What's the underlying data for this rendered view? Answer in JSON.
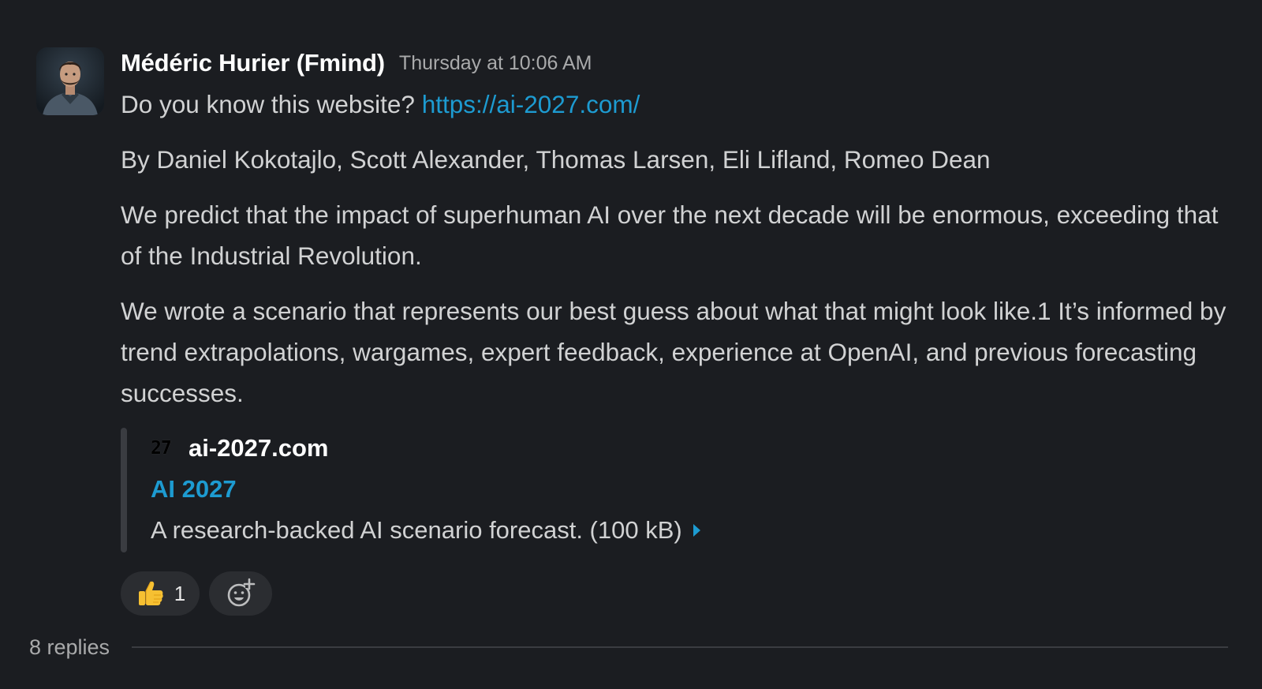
{
  "message": {
    "sender": "Médéric Hurier (Fmind)",
    "timestamp": "Thursday at 10:06 AM",
    "intro_text": "Do you know this website? ",
    "intro_link": "https://ai-2027.com/",
    "authors": "By Daniel Kokotajlo, Scott Alexander, Thomas Larsen, Eli Lifland, Romeo Dean",
    "paragraph_1": "We predict that the impact of superhuman AI over the next decade will be enormous, exceeding that of the Industrial Revolution.",
    "paragraph_2": "We wrote a scenario that represents our best guess about what that might look like.1 It’s informed by trend extrapolations, wargames, expert feedback, experience at OpenAI, and previous forecasting successes."
  },
  "unfurl": {
    "favicon_text": "27",
    "site_name": "ai-2027.com",
    "title": "AI 2027",
    "description": "A research-backed AI scenario forecast. (100 kB)",
    "expand_icon": "caret-right-icon"
  },
  "reactions": [
    {
      "emoji": "thumbs-up-icon",
      "count": "1"
    },
    {
      "emoji": "add-reaction-icon"
    }
  ],
  "thread": {
    "replies_label": "8 replies"
  },
  "colors": {
    "background": "#1b1d21",
    "text": "#d1d2d3",
    "link": "#1d9bd1",
    "muted": "#a9aaab",
    "reaction_pill": "#2b2d31"
  }
}
